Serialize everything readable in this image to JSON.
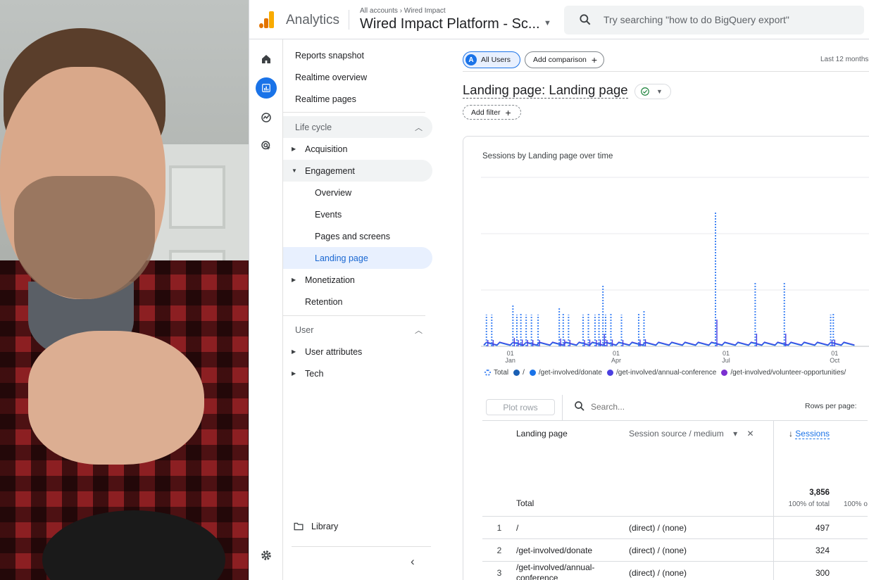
{
  "topbar": {
    "app_name": "Analytics",
    "breadcrumb": "All accounts › Wired Impact",
    "property": "Wired Impact Platform - Sc...",
    "search_placeholder": "Try searching \"how to do BigQuery export\""
  },
  "nav": {
    "items": [
      {
        "label": "Reports snapshot"
      },
      {
        "label": "Realtime overview"
      },
      {
        "label": "Realtime pages"
      }
    ],
    "lifecycle": {
      "header": "Life cycle",
      "acquisition": "Acquisition",
      "engagement": "Engagement",
      "engagement_children": [
        "Overview",
        "Events",
        "Pages and screens",
        "Landing page"
      ],
      "monetization": "Monetization",
      "retention": "Retention"
    },
    "user": {
      "header": "User",
      "user_attributes": "User attributes",
      "tech": "Tech"
    },
    "library": "Library"
  },
  "main": {
    "all_users_avatar": "A",
    "all_users": "All Users",
    "add_comparison": "Add comparison",
    "date_range": "Last 12 months",
    "title": "Landing page: Landing page",
    "add_filter": "Add filter",
    "chart_title": "Sessions by Landing page over time",
    "legend": [
      "Total",
      "/",
      "/get-involved/donate",
      "/get-involved/annual-conference",
      "/get-involved/volunteer-opportunities/"
    ],
    "plot_rows": "Plot rows",
    "search_placeholder": "Search...",
    "rows_per_page": "Rows per page:"
  },
  "table": {
    "col_landing_page": "Landing page",
    "col_source": "Session source / medium",
    "col_sessions": "Sessions",
    "total_label": "Total",
    "total_sessions": "3,856",
    "total_pct": "100% of total",
    "total_pct_next": "100% o",
    "rows": [
      {
        "num": "1",
        "page": "/",
        "source": "(direct) / (none)",
        "sessions": "497"
      },
      {
        "num": "2",
        "page": "/get-involved/donate",
        "source": "(direct) / (none)",
        "sessions": "324"
      },
      {
        "num": "3",
        "page": "/get-involved/annual-conference",
        "source": "(direct) / (none)",
        "sessions": "300"
      }
    ]
  },
  "chart_data": {
    "type": "line",
    "title": "Sessions by Landing page over time",
    "x_ticks": [
      {
        "day": "01",
        "month": "Jan"
      },
      {
        "day": "01",
        "month": "Apr"
      },
      {
        "day": "01",
        "month": "Jul"
      },
      {
        "day": "01",
        "month": "Oct"
      }
    ],
    "series": [
      {
        "name": "Total",
        "color": "#4285f4",
        "spikes": [
          [
            2,
            45
          ],
          [
            6,
            45
          ],
          [
            22,
            60
          ],
          [
            25,
            45
          ],
          [
            28,
            48
          ],
          [
            32,
            45
          ],
          [
            36,
            45
          ],
          [
            41,
            45
          ],
          [
            57,
            55
          ],
          [
            60,
            48
          ],
          [
            64,
            45
          ],
          [
            75,
            45
          ],
          [
            79,
            48
          ],
          [
            84,
            45
          ],
          [
            87,
            48
          ],
          [
            90,
            88
          ],
          [
            92,
            45
          ],
          [
            96,
            48
          ],
          [
            104,
            45
          ],
          [
            117,
            48
          ],
          [
            121,
            50
          ],
          [
            175,
            190
          ],
          [
            205,
            90
          ],
          [
            227,
            90
          ],
          [
            262,
            45
          ],
          [
            264,
            47
          ]
        ]
      },
      {
        "name": "/",
        "color": "#1a5fb4"
      },
      {
        "name": "/get-involved/donate",
        "color": "#1a73e8"
      },
      {
        "name": "/get-involved/annual-conference",
        "color": "#4b3fe0"
      },
      {
        "name": "/get-involved/volunteer-opportunities/",
        "color": "#7b2fd0"
      }
    ]
  }
}
